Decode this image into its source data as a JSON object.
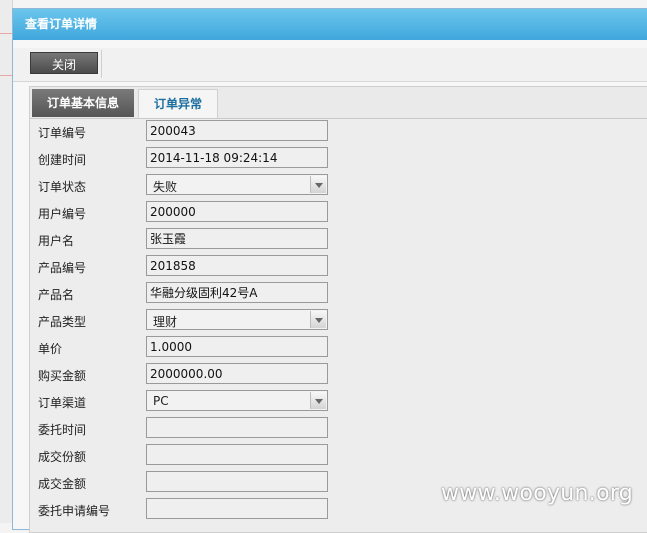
{
  "dialog": {
    "title": "查看订单详情"
  },
  "toolbar": {
    "close_label": "关闭"
  },
  "tabs": [
    {
      "label": "订单基本信息",
      "active": true
    },
    {
      "label": "订单异常",
      "active": false
    }
  ],
  "form": {
    "fields": [
      {
        "label": "订单编号",
        "value": "200043",
        "type": "text"
      },
      {
        "label": "创建时间",
        "value": "2014-11-18 09:24:14",
        "type": "text"
      },
      {
        "label": "订单状态",
        "value": "失败",
        "type": "select"
      },
      {
        "label": "用户编号",
        "value": "200000",
        "type": "text"
      },
      {
        "label": "用户名",
        "value": "张玉霞",
        "type": "text"
      },
      {
        "label": "产品编号",
        "value": "201858",
        "type": "text"
      },
      {
        "label": "产品名",
        "value": "华融分级固利42号A",
        "type": "text"
      },
      {
        "label": "产品类型",
        "value": "理财",
        "type": "select"
      },
      {
        "label": "单价",
        "value": "1.0000",
        "type": "text"
      },
      {
        "label": "购买金额",
        "value": "2000000.00",
        "type": "text"
      },
      {
        "label": "订单渠道",
        "value": "PC",
        "type": "select"
      },
      {
        "label": "委托时间",
        "value": "",
        "type": "text"
      },
      {
        "label": "成交份额",
        "value": "",
        "type": "text"
      },
      {
        "label": "成交金额",
        "value": "",
        "type": "text"
      },
      {
        "label": "委托申请编号",
        "value": "",
        "type": "text"
      }
    ]
  },
  "watermark": "www.wooyun.org",
  "colors": {
    "titlebar": "#4fb3e4",
    "tab_active": "#5f5f5f",
    "tab_inactive_text": "#1d6fa0"
  }
}
